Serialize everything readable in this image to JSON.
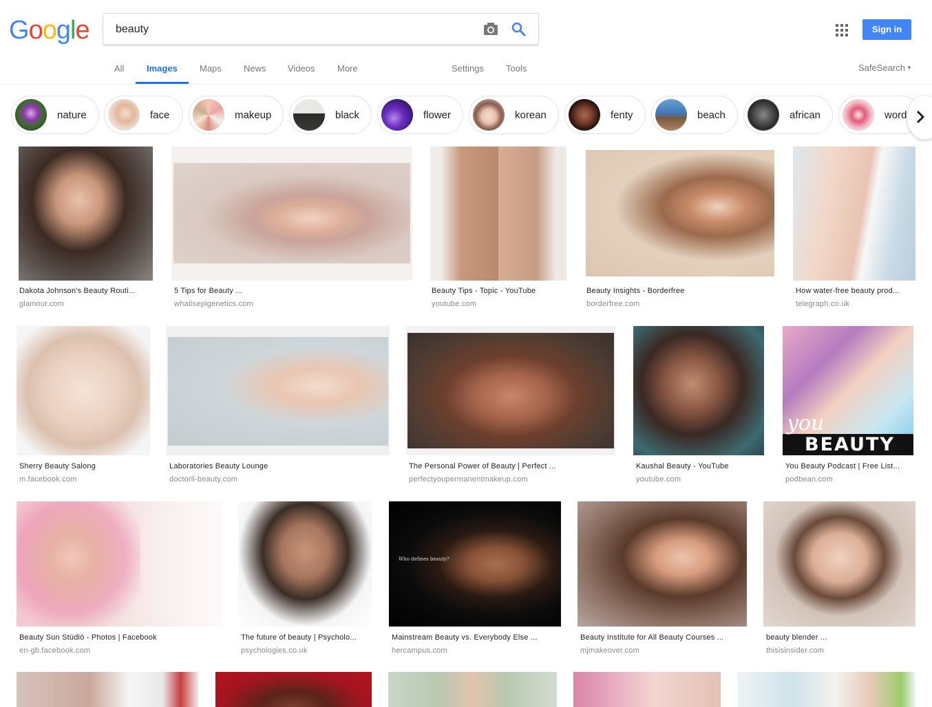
{
  "brand": {
    "letters": [
      "G",
      "o",
      "o",
      "g",
      "l",
      "e"
    ],
    "colors": [
      "#4285f4",
      "#ea4335",
      "#fbbc05",
      "#4285f4",
      "#34a853",
      "#ea4335"
    ]
  },
  "search": {
    "value": "beauty",
    "placeholder": ""
  },
  "header": {
    "signin_label": "Sign in",
    "accent": "#4285f4"
  },
  "nav": {
    "tabs": [
      "All",
      "Images",
      "Maps",
      "News",
      "Videos",
      "More"
    ],
    "settings": "Settings",
    "tools": "Tools",
    "safesearch": "SafeSearch"
  },
  "chips": [
    {
      "label": "nature"
    },
    {
      "label": "face"
    },
    {
      "label": "makeup"
    },
    {
      "label": "black"
    },
    {
      "label": "flower"
    },
    {
      "label": "korean"
    },
    {
      "label": "fenty"
    },
    {
      "label": "beach"
    },
    {
      "label": "african"
    },
    {
      "label": "word"
    }
  ],
  "results": [
    {
      "title": "Dakota Johnson's Beauty Routi...",
      "source": "glamour.com"
    },
    {
      "title": "5 Tips for Beauty ...",
      "source": "whatisepigenetics.com"
    },
    {
      "title": "Beauty Tips - Topic - YouTube",
      "source": "youtube.com"
    },
    {
      "title": "Beauty Insights - Borderfree",
      "source": "borderfree.com"
    },
    {
      "title": "How water-free beauty prod...",
      "source": "telegraph.co.uk"
    },
    {
      "title": "Sherry Beauty Salong",
      "source": "m.facebook.com"
    },
    {
      "title": "Laboratories Beauty Lounge",
      "source": "doctorli-beauty.com"
    },
    {
      "title": "The Personal Power of Beauty | Perfect ...",
      "source": "perfectyoupermanentmakeup.com"
    },
    {
      "title": "Kaushal Beauty - YouTube",
      "source": "youtube.com"
    },
    {
      "title": "You Beauty Podcast | Free List...",
      "source": "podbean.com"
    },
    {
      "title": "Beauty Sun Stúdió - Photos | Facebook",
      "source": "en-gb.facebook.com"
    },
    {
      "title": "The future of beauty | Psycholo...",
      "source": "psychologies.co.uk"
    },
    {
      "title": "Mainstream Beauty vs. Everybody Else ...",
      "source": "hercampus.com"
    },
    {
      "title": "Beauty Institute for All Beauty Courses ...",
      "source": "mjmakeover.com"
    },
    {
      "title": "beauty blender ...",
      "source": "thisisinsider.com"
    }
  ],
  "image_text": {
    "who_defines": "Who defines beauty?",
    "you": "you",
    "beauty_word": "BEAUTY"
  }
}
